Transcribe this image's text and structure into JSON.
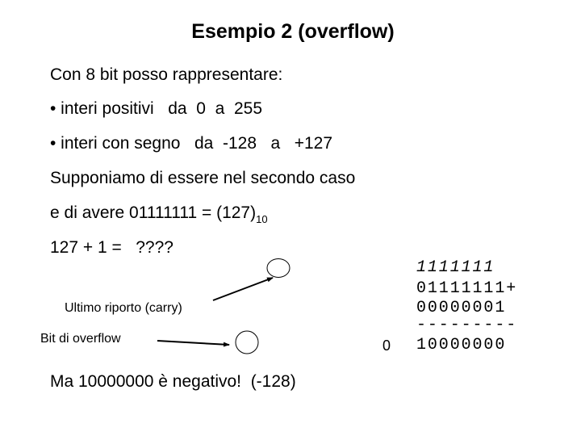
{
  "slide": {
    "title": "Esempio 2 (overflow)",
    "lines": {
      "intro": "Con 8 bit posso rappresentare:",
      "bullet_unsigned": "• interi positivi   da  0  a  255",
      "bullet_signed": "• interi con segno   da  -128   a   +127",
      "assume": "Supponiamo di essere nel secondo caso",
      "have_prefix": "e di avere 01111111 = (127)",
      "have_base": "10",
      "question": "127 + 1 =   ????",
      "conclusion": "Ma 10000000 è negativo!  (-128)"
    },
    "annotations": {
      "carry_label": "Ultimo riporto (carry)",
      "overflow_label": "Bit di overflow",
      "overflow_value": "0"
    },
    "addition": {
      "carries": "1111111",
      "operand_a": "01111111+",
      "operand_b": "00000001",
      "separator": "---------",
      "result": "10000000"
    }
  }
}
